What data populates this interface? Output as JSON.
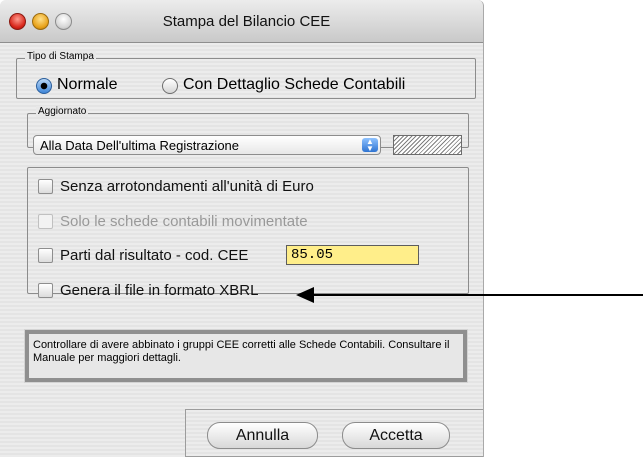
{
  "window": {
    "title": "Stampa del Bilancio CEE"
  },
  "print_type": {
    "label": "Tipo di Stampa",
    "options": [
      {
        "label": "Normale",
        "selected": true
      },
      {
        "label": "Con Dettaglio Schede Contabili",
        "selected": false
      }
    ]
  },
  "updated": {
    "label": "Aggiornato",
    "selected": "Alla Data Dell'ultima Registrazione"
  },
  "options": {
    "items": [
      {
        "label": "Senza arrotondamenti all'unità di Euro",
        "checked": false,
        "enabled": true
      },
      {
        "label": "Solo le schede contabili movimentate",
        "checked": false,
        "enabled": false
      },
      {
        "label": "Parti dal risultato - cod. CEE",
        "checked": false,
        "enabled": true
      },
      {
        "label": "Genera il file in formato XBRL",
        "checked": false,
        "enabled": true
      }
    ],
    "cee_code_value": "85.05"
  },
  "note": {
    "text": "Controllare di avere abbinato i gruppi CEE corretti alle Schede Contabili. Consultare il Manuale per maggiori dettagli."
  },
  "actions": {
    "cancel": "Annulla",
    "accept": "Accetta"
  },
  "colors": {
    "accent": "#3f86d8",
    "input_highlight": "#ffee8a"
  }
}
